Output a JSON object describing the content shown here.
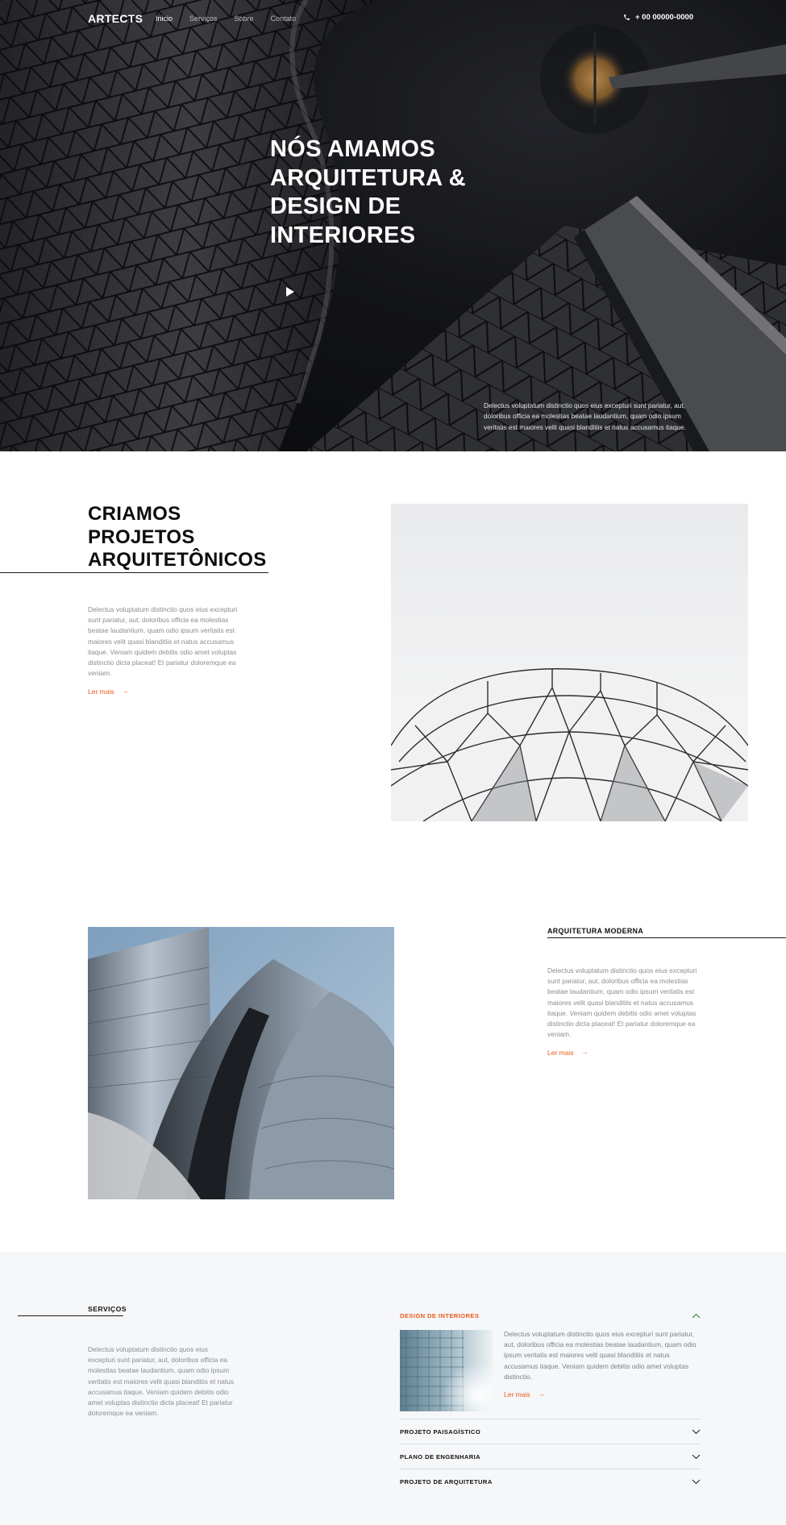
{
  "header": {
    "brand": "ARTECTS",
    "nav": [
      "Inicio",
      "Serviços",
      "Sobre",
      "Contato"
    ],
    "active_nav": "Inicio",
    "phone": "+ 00 00000-0000"
  },
  "hero": {
    "title": "NÓS AMAMOS ARQUITETURA & DESIGN DE INTERIORES",
    "text": "Delectus voluptatum distinctio quos eius excepturi sunt pariatur, aut, doloribus officia ea molestias beatae laudantium, quam odio ipsum veritatis est maiores velit quasi blanditiis et natus accusamus itaque."
  },
  "projects": {
    "title": "CRIAMOS PROJETOS ARQUITETÔNICOS",
    "text": "Delectus voluptatum distinctio quos eius excepturi sunt pariatur, aut, doloribus officia ea molestias beatae laudantium, quam odio ipsum veritatis est maiores velit quasi blanditiis et natus accusamus itaque. Veniam quidem debitis odio amet voluptas distinctio dicta placeat! Et pariatur doloremque ea veniam.",
    "read_more": "Ler mais"
  },
  "modern": {
    "title": "ARQUITETURA MODERNA",
    "text": "Delectus voluptatum distinctio quos eius excepturi sunt pariatur, aut, doloribus officia ea molestias beatae laudantium, quam odio ipsum veritatis est maiores velit quasi blanditiis et natus accusamus itaque. Veniam quidem debitis odio amet voluptas distinctio dicta placeat! Et pariatur doloremque ea veniam.",
    "read_more": "Ler mais"
  },
  "services": {
    "title": "SERVIÇOS",
    "text": "Delectus voluptatum distinctio quos eius excepturi sunt pariatur, aut, doloribus officia ea molestias beatae laudantium, quam odio ipsum veritatis est maiores velit quasi blanditiis et natus accusamus itaque. Veniam quidem debitis odio amet voluptas distinctio dicta placeat! Et pariatur doloremque ea veniam.",
    "accordion": {
      "open_title": "DESIGN DE INTERIORES",
      "open_text": "Delectus voluptatum distinctio quos eius excepturi sunt pariatur, aut, doloribus officia ea molestias beatae laudantium, quam odio ipsum veritatis est maiores velit quasi blanditiis et natus accusamus itaque. Veniam quidem debitis odio amet voluptas distinctio.",
      "read_more": "Ler mais",
      "items": [
        "PROJETO PAISAGÍSTICO",
        "PLANO DE ENGENHARIA",
        "PROJETO DE ARQUITETURA"
      ]
    }
  },
  "colors": {
    "accent": "#e85a1a",
    "dark": "#111111",
    "muted_text": "#8a8c93",
    "services_bg": "#f6f7f9"
  },
  "icons": {
    "phone": "phone-icon",
    "play": "play-icon",
    "arrow": "arrow-right-icon",
    "chevron_up": "chevron-up-icon",
    "chevron_down": "chevron-down-icon"
  }
}
